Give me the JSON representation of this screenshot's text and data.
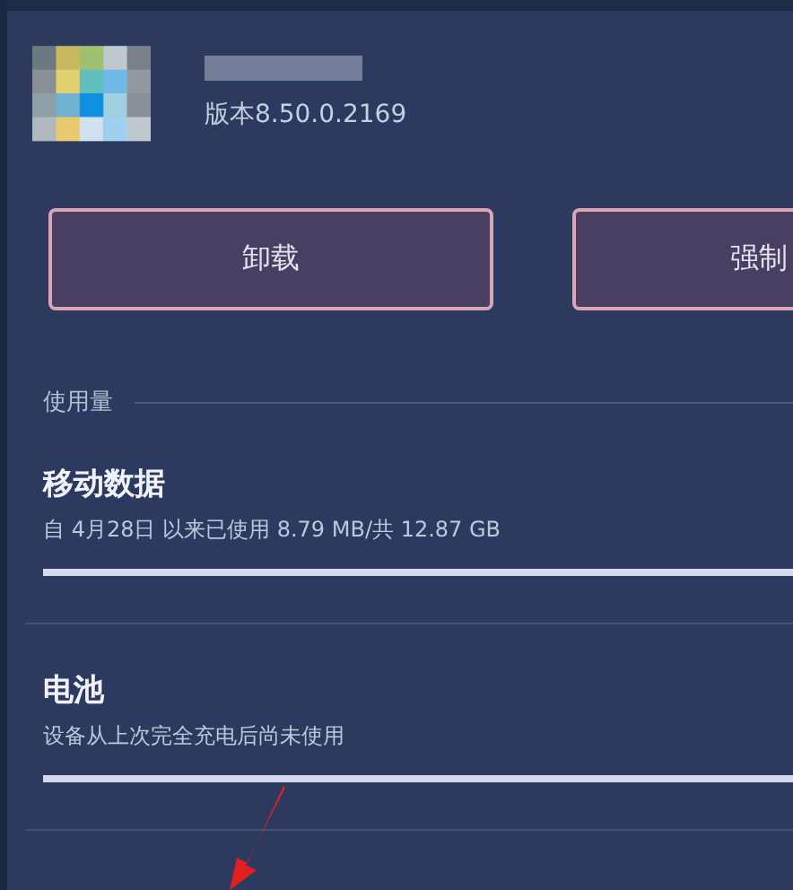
{
  "app": {
    "version": "版本8.50.0.2169"
  },
  "buttons": [
    {
      "label": "卸载"
    },
    {
      "label": "强制"
    }
  ],
  "usage": {
    "header": "使用量",
    "items": [
      {
        "title": "移动数据",
        "detail": "自 4月28日 以来已使用 8.79 MB/共 12.87 GB",
        "level": 1
      },
      {
        "title": "电池",
        "detail": "设备从上次完全充电后尚未使用",
        "level": 1
      }
    ]
  }
}
